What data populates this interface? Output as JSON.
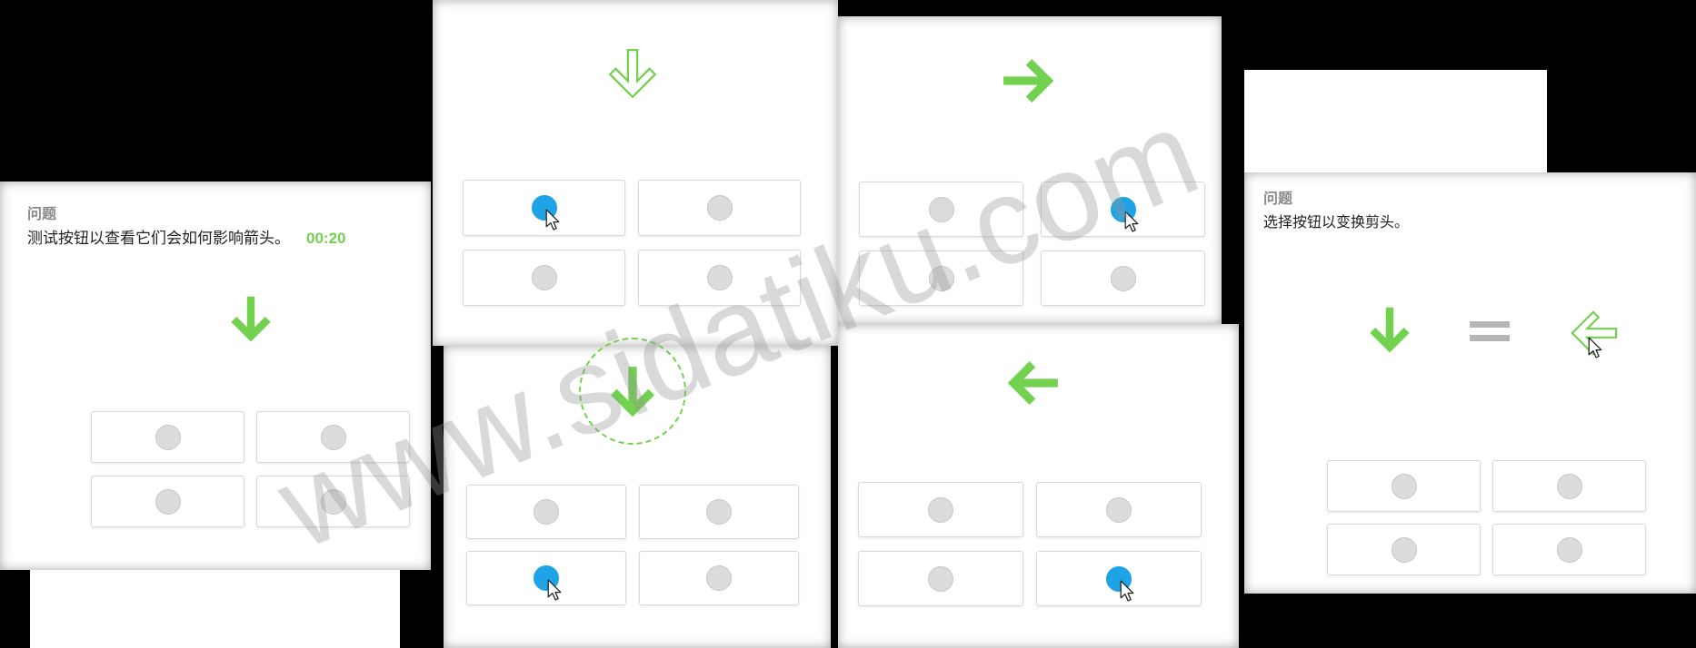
{
  "colors": {
    "accent_green": "#72d14f",
    "selected_blue": "#1ea3e6",
    "option_gray": "#dcdcdc",
    "equals_gray": "#b5b5b5"
  },
  "cursor_icon": "cursor-icon",
  "intro": {
    "label": "问题",
    "instruction": "测试按钮以查看它们会如何影响箭头。",
    "timer": "00:20",
    "arrow_icon": "arrow-down-icon",
    "options": [
      false,
      false,
      false,
      false
    ]
  },
  "step_1": {
    "arrow_icon": "arrow-down-outline-icon",
    "options": [
      true,
      false,
      false,
      false
    ]
  },
  "step_2": {
    "arrow_icon": "arrow-down-icon",
    "options": [
      false,
      false,
      true,
      false
    ]
  },
  "step_3": {
    "arrow_icon": "arrow-right-icon",
    "options": [
      false,
      true,
      false,
      false
    ]
  },
  "step_4": {
    "arrow_icon": "arrow-left-icon",
    "options": [
      false,
      false,
      false,
      true
    ]
  },
  "question": {
    "label": "问题",
    "instruction": "选择按钮以变换剪头。",
    "source_icon": "arrow-down-icon",
    "operator_icon": "equals-icon",
    "target_icon": "arrow-left-outline-icon",
    "pointer_icon": "cursor-icon",
    "options": [
      false,
      false,
      false,
      false
    ]
  },
  "watermark": "www.sidatiku.com"
}
